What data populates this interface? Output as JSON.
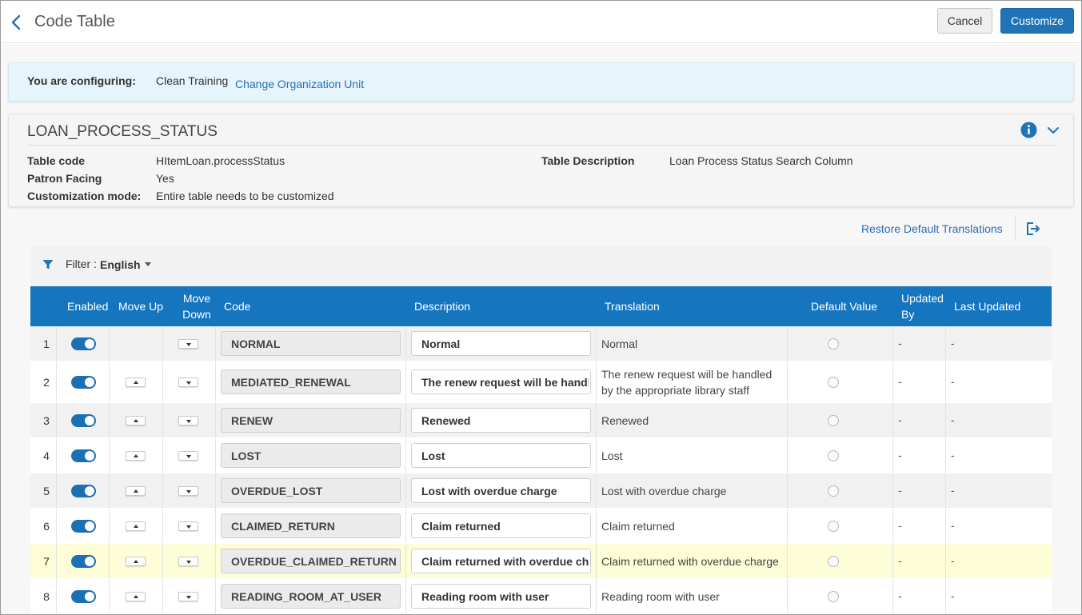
{
  "header": {
    "title": "Code Table",
    "cancel_label": "Cancel",
    "customize_label": "Customize"
  },
  "config": {
    "label": "You are configuring:",
    "org": "Clean Training",
    "change_link": "Change Organization Unit"
  },
  "table_info": {
    "name": "LOAN_PROCESS_STATUS",
    "fields": {
      "table_code_label": "Table code",
      "table_code_value": "HItemLoan.processStatus",
      "patron_facing_label": "Patron Facing",
      "patron_facing_value": "Yes",
      "customization_mode_label": "Customization mode:",
      "customization_mode_value": "Entire table needs to be customized",
      "table_description_label": "Table Description",
      "table_description_value": "Loan Process Status Search Column"
    }
  },
  "actions": {
    "restore_label": "Restore Default Translations"
  },
  "filter": {
    "label": "Filter :",
    "value": "English"
  },
  "columns": [
    "Enabled",
    "Move Up",
    "Move Down",
    "Code",
    "Description",
    "Translation",
    "Default Value",
    "Updated By",
    "Last Updated"
  ],
  "rows": [
    {
      "num": "1",
      "code": "NORMAL",
      "description": "Normal",
      "translation": "Normal",
      "updated_by": "-",
      "last_updated": "-",
      "enabled": true
    },
    {
      "num": "2",
      "code": "MEDIATED_RENEWAL",
      "description": "The renew request will be handled by the appropriate library staff",
      "translation": "The renew request will be handled by the appropriate library staff",
      "updated_by": "-",
      "last_updated": "-",
      "enabled": true
    },
    {
      "num": "3",
      "code": "RENEW",
      "description": "Renewed",
      "translation": "Renewed",
      "updated_by": "-",
      "last_updated": "-",
      "enabled": true
    },
    {
      "num": "4",
      "code": "LOST",
      "description": "Lost",
      "translation": "Lost",
      "updated_by": "-",
      "last_updated": "-",
      "enabled": true
    },
    {
      "num": "5",
      "code": "OVERDUE_LOST",
      "description": "Lost with overdue charge",
      "translation": "Lost with overdue charge",
      "updated_by": "-",
      "last_updated": "-",
      "enabled": true
    },
    {
      "num": "6",
      "code": "CLAIMED_RETURN",
      "description": "Claim returned",
      "translation": "Claim returned",
      "updated_by": "-",
      "last_updated": "-",
      "enabled": true
    },
    {
      "num": "7",
      "code": "OVERDUE_CLAIMED_RETURN",
      "description": "Claim returned with overdue charge",
      "translation": "Claim returned with overdue charge",
      "updated_by": "-",
      "last_updated": "-",
      "enabled": true
    },
    {
      "num": "8",
      "code": "READING_ROOM_AT_USER",
      "description": "Reading room with user",
      "translation": "Reading room with user",
      "updated_by": "-",
      "last_updated": "-",
      "enabled": true
    }
  ],
  "colors": {
    "primary": "#1f73b7",
    "header_bg": "#1675bf",
    "link": "#2a6db5",
    "banner_bg": "#e5f5fb",
    "highlight_row": "#fdfdd7"
  }
}
